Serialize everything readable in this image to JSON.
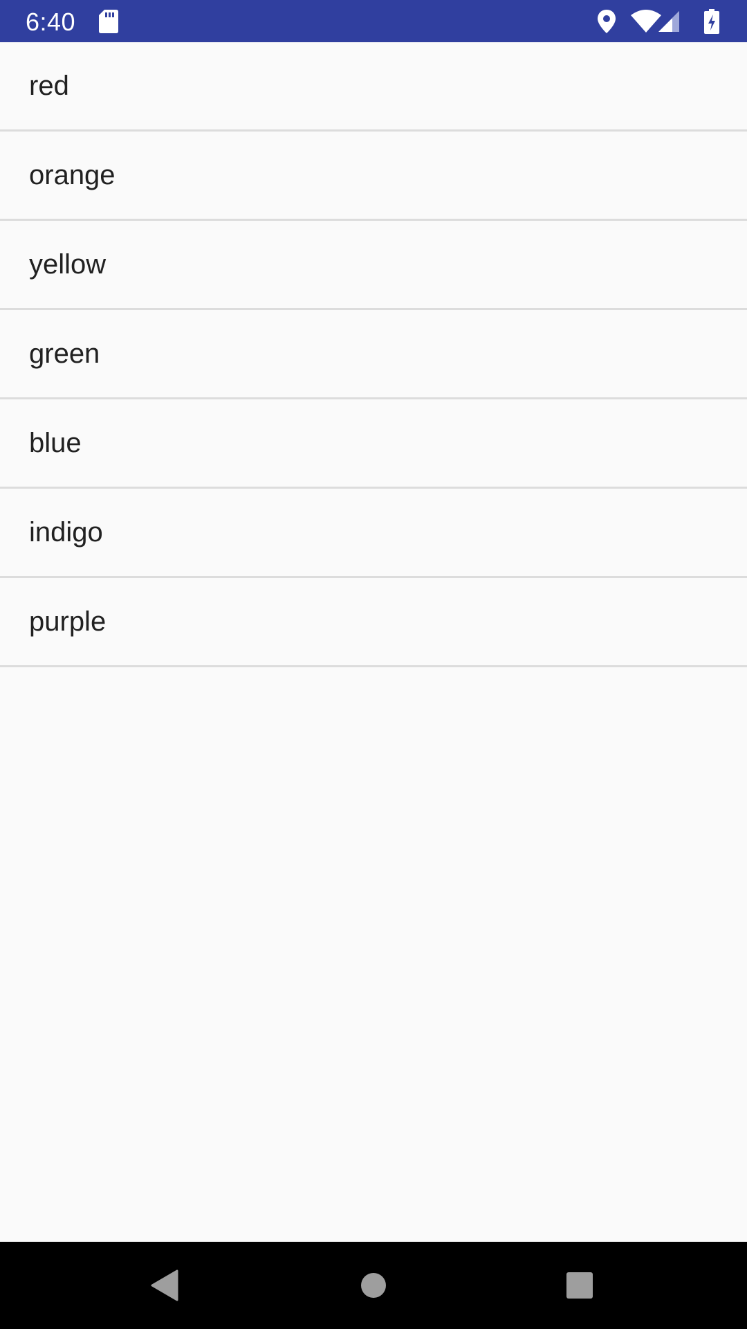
{
  "status_bar": {
    "time": "6:40",
    "background": "#303f9f",
    "icons": [
      "sd-card-icon",
      "location-icon",
      "wifi-icon",
      "cell-signal-icon",
      "battery-charging-icon"
    ]
  },
  "list": {
    "items": [
      {
        "label": "red"
      },
      {
        "label": "orange"
      },
      {
        "label": "yellow"
      },
      {
        "label": "green"
      },
      {
        "label": "blue"
      },
      {
        "label": "indigo"
      },
      {
        "label": "purple"
      }
    ],
    "text_color": "#212121",
    "divider_color": "#dcdcdc"
  },
  "nav_bar": {
    "buttons": [
      "back-icon",
      "home-icon",
      "recents-icon"
    ],
    "icon_color": "#9e9e9e"
  }
}
